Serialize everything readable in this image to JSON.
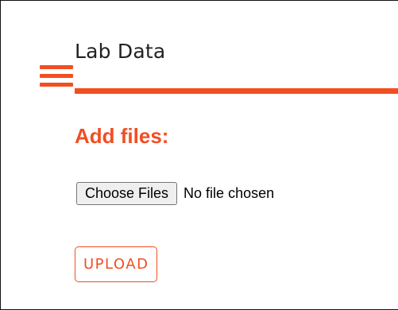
{
  "header": {
    "title": "Lab Data",
    "menu_icon": "hamburger-menu-icon"
  },
  "upload_section": {
    "heading": "Add files:",
    "choose_files_label": "Choose Files",
    "file_status": "No file chosen",
    "upload_label": "UPLOAD"
  },
  "colors": {
    "accent": "#f24e22",
    "text": "#222222",
    "button_bg": "#efefef"
  }
}
